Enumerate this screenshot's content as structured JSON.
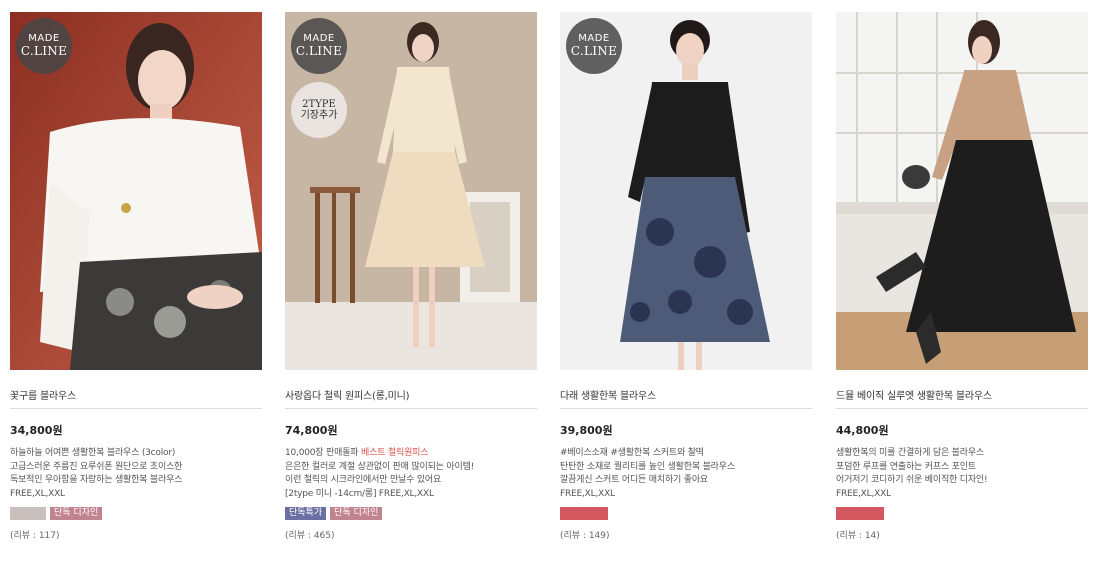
{
  "products": [
    {
      "name": "꽃구름 블라우스",
      "price": "34,800원",
      "badge_made": [
        "MADE",
        "C.LINE"
      ],
      "badge_type": null,
      "desc_lines": [
        {
          "parts": [
            {
              "text": "하늘하늘 어여쁜 생활한복 블라우스 (3color)",
              "hl": false
            }
          ]
        },
        {
          "parts": [
            {
              "text": "고급스러운 주름진 요루쉬폰 원단으로 초이스한",
              "hl": false
            }
          ]
        },
        {
          "parts": [
            {
              "text": "독보적인 우아함을 자랑하는 생활한복 블라우스",
              "hl": false
            }
          ]
        }
      ],
      "size": "FREE,XL,XXL",
      "tags": [
        {
          "label": "",
          "style": "grey"
        },
        {
          "label": "단독 디자인",
          "style": "rose"
        }
      ],
      "review": "(리뷰 : 117)"
    },
    {
      "name": "사랑옵다 철릭 원피스(롱,미니)",
      "price": "74,800원",
      "badge_made": [
        "MADE",
        "C.LINE"
      ],
      "badge_type": [
        "2TYPE",
        "기장추가"
      ],
      "desc_lines": [
        {
          "parts": [
            {
              "text": "10,000장 판매돌파 ",
              "hl": false
            },
            {
              "text": "베스트 철릭원피스",
              "hl": true
            }
          ]
        },
        {
          "parts": [
            {
              "text": "은은한 컬러로 계절 상관없이 판매 많이되는 아이템!",
              "hl": false
            }
          ]
        },
        {
          "parts": [
            {
              "text": "이런 철릭의 시크라인에서만 만날수 있어요",
              "hl": false
            }
          ]
        }
      ],
      "size": "[2type 미니 -14cm/롱] FREE,XL,XXL",
      "tags": [
        {
          "label": "단독특가",
          "style": "navy"
        },
        {
          "label": "단독 디자인",
          "style": "rose"
        }
      ],
      "review": "(리뷰 : 465)"
    },
    {
      "name": "다래 생활한복 블라우스",
      "price": "39,800원",
      "badge_made": [
        "MADE",
        "C.LINE"
      ],
      "badge_type": null,
      "desc_lines": [
        {
          "parts": [
            {
              "text": "#베이스소재 #생활한복 스커트와 찰떡",
              "hl": false
            }
          ]
        },
        {
          "parts": [
            {
              "text": "탄탄한 소재로 퀄리티를 높인 생활한복 블라우스",
              "hl": false
            }
          ]
        },
        {
          "parts": [
            {
              "text": "깔끔게신 스커트 어디든 매치하기 좋아요",
              "hl": false
            }
          ]
        }
      ],
      "size": "FREE,XL,XXL",
      "tags": [
        {
          "label": "",
          "style": "red"
        }
      ],
      "review": "(리뷰 : 149)"
    },
    {
      "name": "드뮬 베이직 실루엣 생활한복 블라우스",
      "price": "44,800원",
      "badge_made": null,
      "badge_type": null,
      "desc_lines": [
        {
          "parts": [
            {
              "text": "생활한복의 미를 간결하게 담은 블라우스",
              "hl": false
            }
          ]
        },
        {
          "parts": [
            {
              "text": "포덤한 루프를 연출하는 커프스 포인트",
              "hl": false
            }
          ]
        },
        {
          "parts": [
            {
              "text": "어거저기 코디하기 쉬운 베이직한 디자인!",
              "hl": false
            }
          ]
        }
      ],
      "size": "FREE,XL,XXL",
      "tags": [
        {
          "label": "",
          "style": "red"
        }
      ],
      "review": "(리뷰 : 14)"
    }
  ]
}
